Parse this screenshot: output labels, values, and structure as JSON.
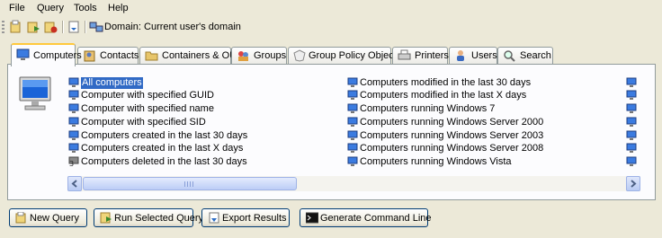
{
  "menu": [
    "File",
    "Query",
    "Tools",
    "Help"
  ],
  "toolbar": {
    "domain_label": "Domain: Current user's domain"
  },
  "tabs": [
    {
      "label": "Computers",
      "icon": "computer-icon"
    },
    {
      "label": "Contacts",
      "icon": "contact-icon"
    },
    {
      "label": "Containers & OUs",
      "icon": "folder-icon"
    },
    {
      "label": "Groups",
      "icon": "group-icon"
    },
    {
      "label": "Group Policy Objects",
      "icon": "policy-icon"
    },
    {
      "label": "Printers",
      "icon": "printer-icon"
    },
    {
      "label": "Users",
      "icon": "user-icon"
    },
    {
      "label": "Search",
      "icon": "search-icon"
    }
  ],
  "queries": {
    "col1": [
      "All computers",
      "Computer with specified GUID",
      "Computer with specified name",
      "Computer with specified SID",
      "Computers created in the last 30 days",
      "Computers created in the last X days",
      "Computers deleted in the last 30 days"
    ],
    "col2": [
      "Computers modified in the last 30 days",
      "Computers modified in the last X days",
      "Computers running Windows 7",
      "Computers running Windows Server 2000",
      "Computers running Windows Server 2003",
      "Computers running Windows Server 2008",
      "Computers running Windows Vista"
    ],
    "selected": "All computers"
  },
  "buttons": {
    "new_query": "New Query",
    "run_selected": "Run Selected Query",
    "export": "Export Results",
    "command_line": "Generate Command Line"
  },
  "colors": {
    "selection": "#316ac5",
    "active_tab_border": "#ffc83c",
    "window_bg": "#ece9d8"
  }
}
